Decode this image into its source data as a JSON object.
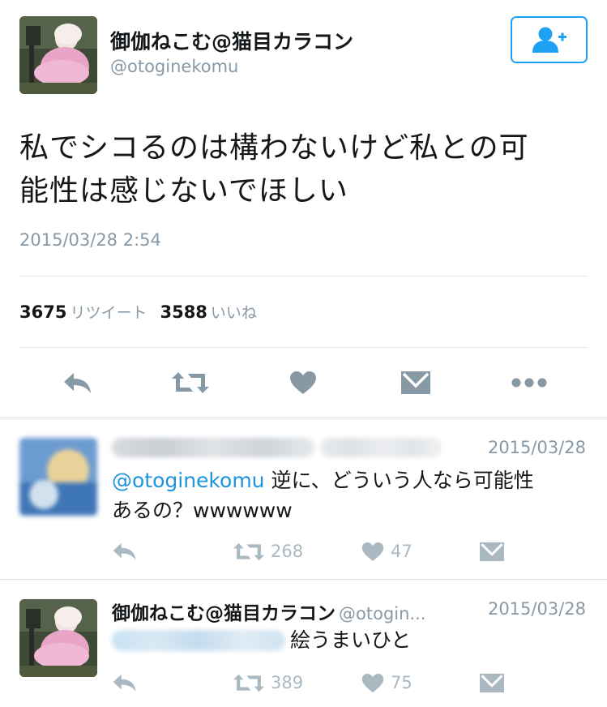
{
  "tweet": {
    "author_name": "御伽ねこむ@猫目カラコン",
    "author_handle": "@otoginekomu",
    "text_line1": "私でシコるのは構わないけど私との可",
    "text_line2": "能性は感じないでほしい",
    "timestamp": "2015/03/28 2:54",
    "retweet_count": "3675",
    "retweet_label": "リツイート",
    "like_count": "3588",
    "like_label": "いいね"
  },
  "replies": [
    {
      "date": "2015/03/28",
      "mention": "@otoginekomu",
      "text_line1": " 逆に、どういう人なら可能性",
      "text_line2": "あるの？wwwwww",
      "retweet_count": "268",
      "like_count": "47"
    },
    {
      "author_name": "御伽ねこむ@猫目カラコン",
      "author_handle": "@otogin...",
      "date": "2015/03/28",
      "text": "絵うまいひと",
      "retweet_count": "389",
      "like_count": "75"
    }
  ],
  "colors": {
    "accent": "#1da1f2",
    "mention": "#1b95e0",
    "muted": "#8899a6",
    "icon": "#8899a6",
    "icon_light": "#aab8c2"
  },
  "icons": [
    "follow-icon",
    "reply-icon",
    "retweet-icon",
    "like-icon",
    "message-icon",
    "more-icon"
  ]
}
